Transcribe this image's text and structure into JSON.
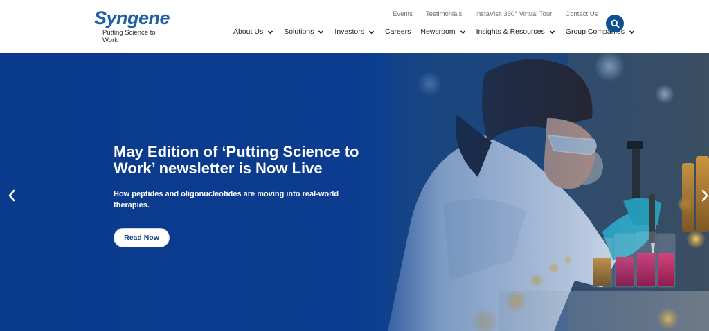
{
  "brand": {
    "logo_text": "Syngene",
    "tagline": "Putting Science to Work"
  },
  "utility_nav": [
    "Events",
    "Testimonials",
    "InstaVisit 360° Virtual Tour",
    "Contact Us"
  ],
  "main_nav": [
    {
      "label": "About Us",
      "dropdown": true
    },
    {
      "label": "Solutions",
      "dropdown": true
    },
    {
      "label": "Investors",
      "dropdown": true
    },
    {
      "label": "Careers",
      "dropdown": false
    },
    {
      "label": "Newsroom",
      "dropdown": true
    },
    {
      "label": "Insights & Resources",
      "dropdown": true
    },
    {
      "label": "Group Companies",
      "dropdown": true
    }
  ],
  "search": {
    "icon": "search-icon"
  },
  "hero": {
    "title": "May Edition of ‘Putting Science to Work’ newsletter is Now Live",
    "subtitle": "How peptides and oligonucleotides are moving into real-world therapies.",
    "cta_label": "Read Now",
    "prev_icon": "chevron-left-icon",
    "next_icon": "chevron-right-icon"
  },
  "colors": {
    "brand_blue": "#1f5fa8",
    "hero_blue": "#0a3a8c",
    "search_bg": "#0f4f93"
  }
}
